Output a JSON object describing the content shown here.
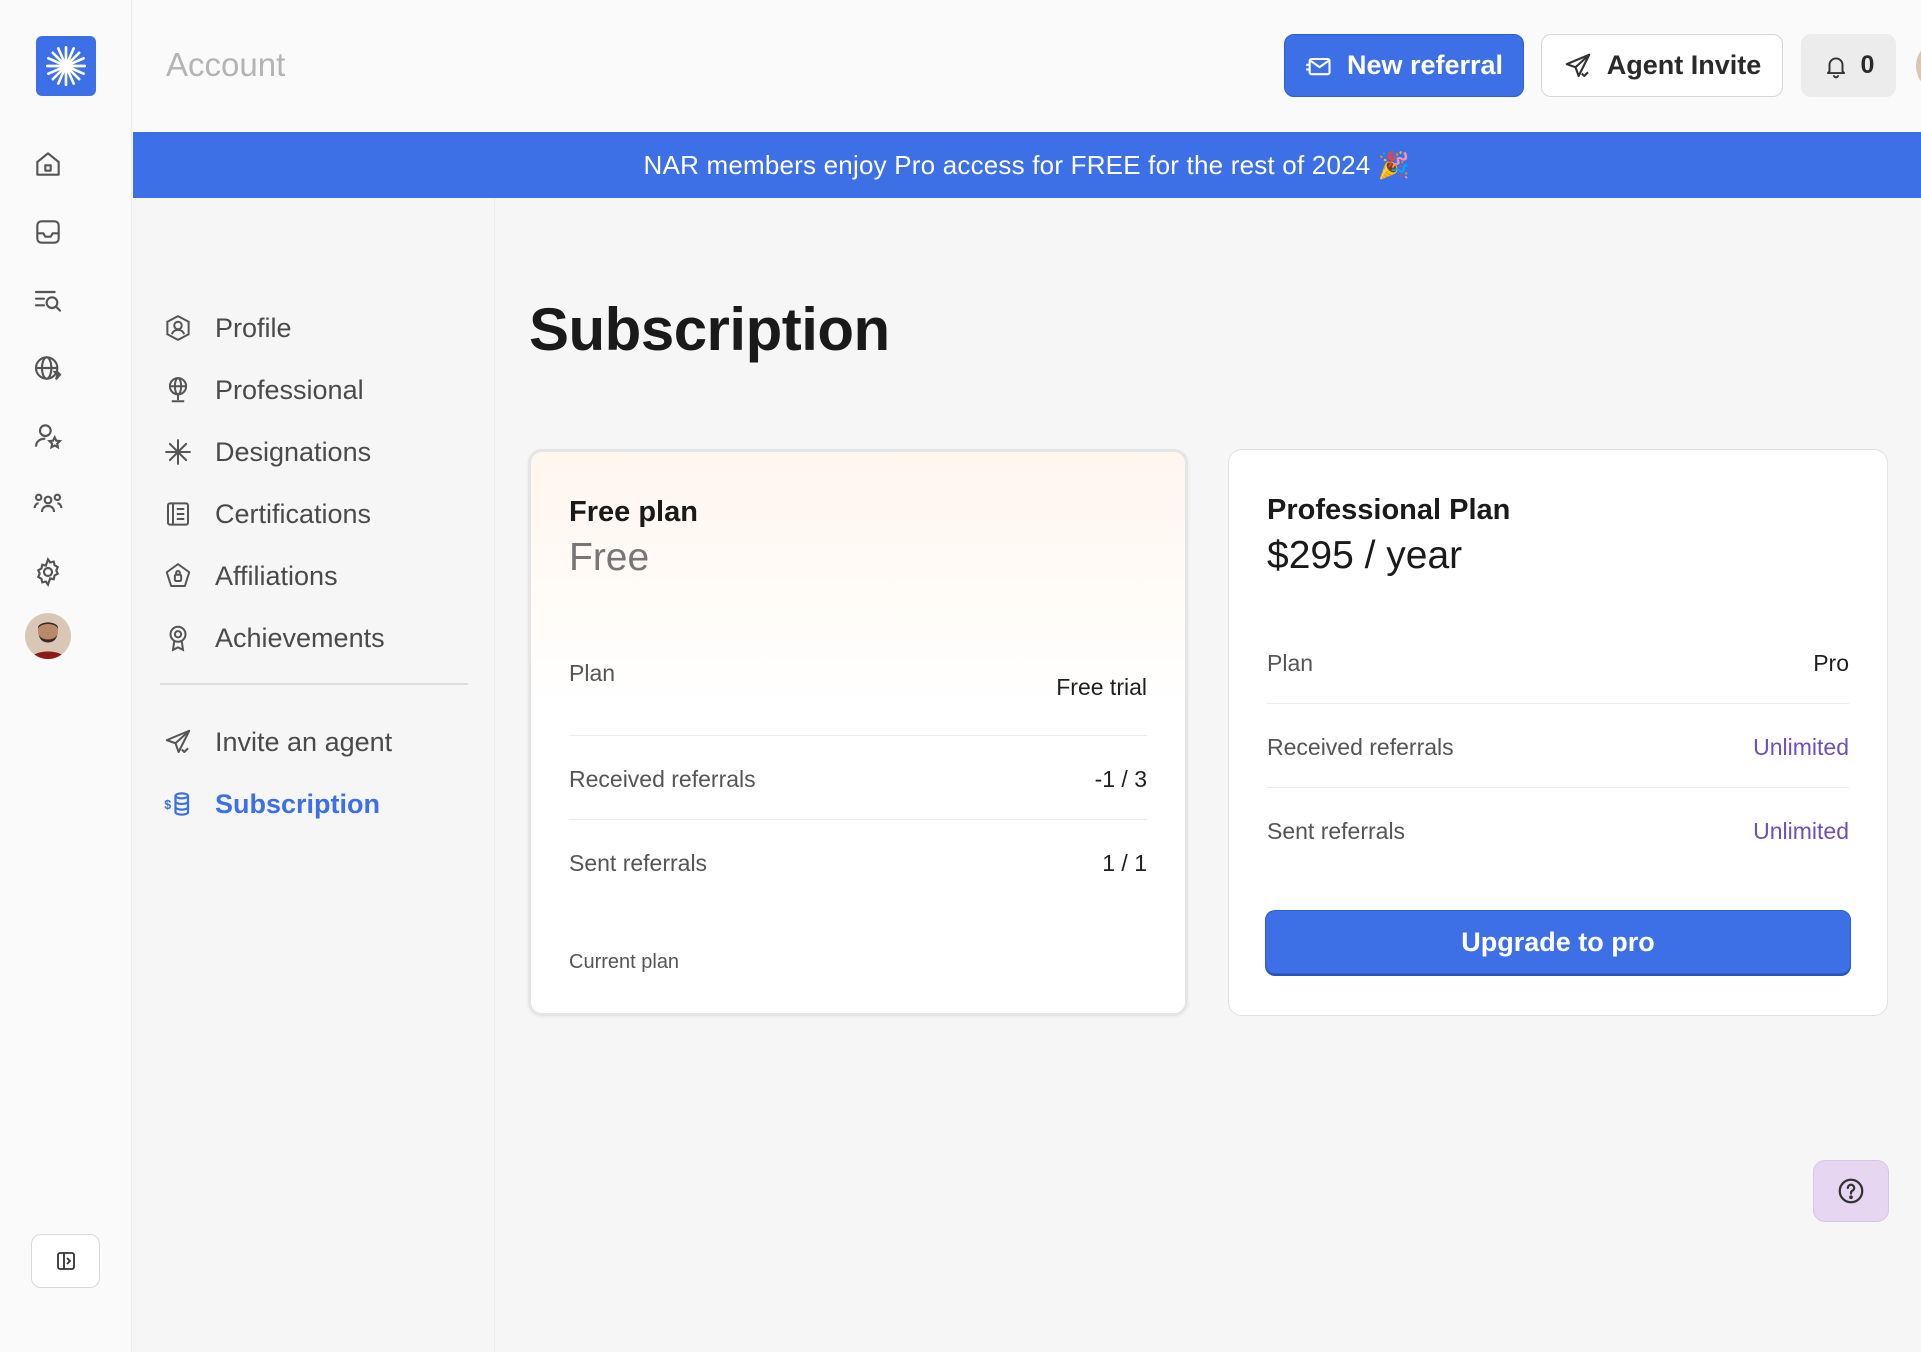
{
  "header": {
    "heading": "Account",
    "new_referral_label": "New referral",
    "agent_invite_label": "Agent Invite",
    "notification_count": "0"
  },
  "banner": {
    "text": "NAR members enjoy Pro access for FREE for the rest of 2024 🎉"
  },
  "rail": {
    "items": [
      "home-icon",
      "inbox-icon",
      "search-list-icon",
      "globe-icon",
      "user-star-icon",
      "team-icon",
      "gear-icon"
    ]
  },
  "subnav": {
    "items": [
      {
        "label": "Profile",
        "icon": "user-circle-icon"
      },
      {
        "label": "Professional",
        "icon": "globe-pin-icon"
      },
      {
        "label": "Designations",
        "icon": "asterisk-icon"
      },
      {
        "label": "Certifications",
        "icon": "certificate-icon"
      },
      {
        "label": "Affiliations",
        "icon": "badge-icon"
      },
      {
        "label": "Achievements",
        "icon": "medal-icon"
      }
    ],
    "secondary": [
      {
        "label": "Invite an agent",
        "icon": "send-icon"
      },
      {
        "label": "Subscription",
        "icon": "coins-icon",
        "active": true
      }
    ]
  },
  "main": {
    "title": "Subscription",
    "free_plan": {
      "name": "Free plan",
      "price": "Free",
      "rows": [
        {
          "key": "Plan",
          "value": "Free trial"
        },
        {
          "key": "Received referrals",
          "value": "-1 / 3"
        },
        {
          "key": "Sent referrals",
          "value": "1 / 1"
        }
      ],
      "status": "Current plan"
    },
    "pro_plan": {
      "name": "Professional Plan",
      "price": "$295 / year",
      "rows": [
        {
          "key": "Plan",
          "value": "Pro"
        },
        {
          "key": "Received referrals",
          "value": "Unlimited"
        },
        {
          "key": "Sent referrals",
          "value": "Unlimited"
        }
      ],
      "cta": "Upgrade to pro"
    }
  },
  "colors": {
    "accent": "#3d6fe6",
    "unlimited": "#6f4fb8",
    "help_bg": "#e6d6f2"
  }
}
